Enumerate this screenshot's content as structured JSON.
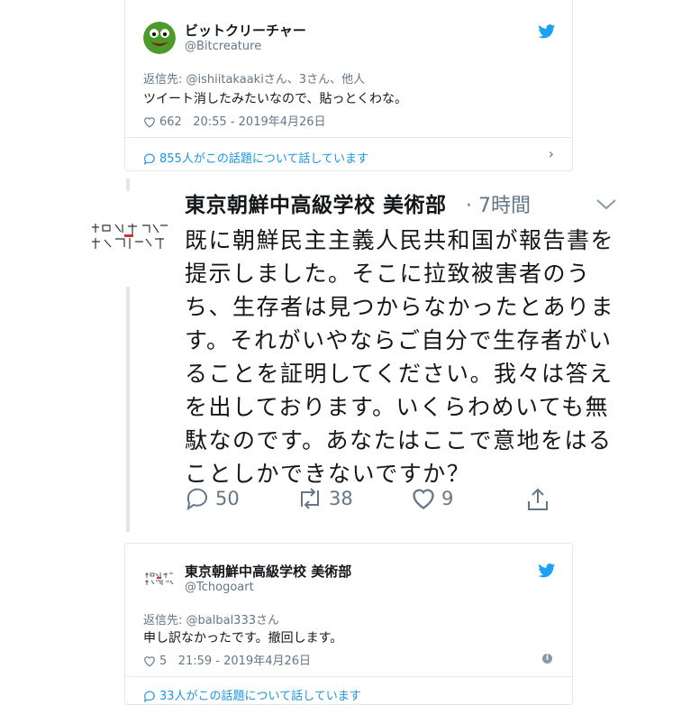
{
  "tweet1": {
    "display_name": "ビットクリーチャー",
    "handle": "@Bitcreature",
    "reply_prefix": "返信先: ",
    "reply_to": "@ishiitakaakiさん、3さん、他人",
    "text": "ツイート消したみたいなので、貼っとくわな。",
    "likes": "662",
    "timestamp": "20:55 - 2019年4月26日",
    "conversation": "855人がこの話題について話しています"
  },
  "tweet2": {
    "display_name": "東京朝鮮中高級学校 美術部",
    "time_ago": "· 7時間",
    "lines": [
      "既に朝鮮民主主義人民共和国が報告書を",
      "提示しました。そこに拉致被害者のう",
      "ち、生存者は見つからなかったとありま",
      "す。それがいやならご自分で生存者がい",
      "ることを証明してください。我々は答え",
      "を出しております。いくらわめいても無",
      "駄なのです。あなたはここで意地をはる",
      "ことしかできないですか？"
    ],
    "replies": "50",
    "retweets": "38",
    "likes": "9"
  },
  "tweet3": {
    "display_name": "東京朝鮮中高級学校 美術部",
    "handle": "@Tchogoart",
    "reply_prefix": "返信先: ",
    "reply_to": "@balbal333さん",
    "text": "申し訳なかったです。撤回します。",
    "likes": "5",
    "timestamp": "21:59 - 2019年4月26日",
    "conversation": "33人がこの話題について話しています"
  },
  "colors": {
    "twitter_blue": "#1da1f2",
    "link": "#1b95e0",
    "muted": "#657786",
    "border": "#e1e8ed"
  },
  "icons": [
    "twitter-bird-icon",
    "heart-icon",
    "speech-bubble-icon",
    "chevron-right-icon",
    "chevron-down-icon",
    "reply-icon",
    "retweet-icon",
    "share-icon",
    "info-icon"
  ]
}
